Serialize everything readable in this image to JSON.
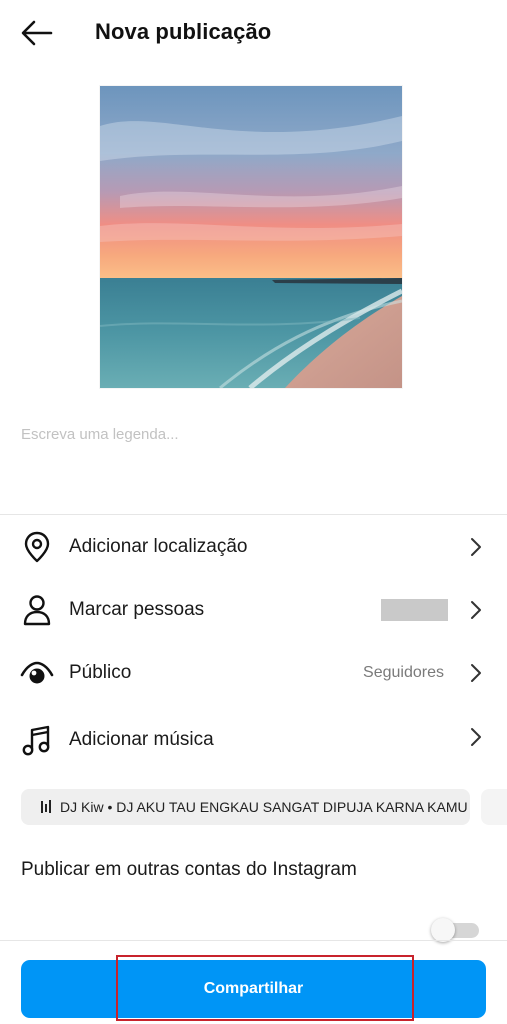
{
  "header": {
    "title": "Nova publicação",
    "back_icon": "arrow-left-icon"
  },
  "post": {
    "image": "sunset beach photo",
    "caption_placeholder": "Escreva uma legenda...",
    "caption_value": ""
  },
  "options": [
    {
      "icon": "location-pin-icon",
      "label": "Adicionar localização"
    },
    {
      "icon": "person-icon",
      "label": "Marcar pessoas"
    },
    {
      "icon": "eye-icon",
      "label": "Público",
      "value": "Seguidores"
    },
    {
      "icon": "music-note-icon",
      "label": "Adicionar música"
    }
  ],
  "music_suggestion": {
    "icon": "audio-bars-icon",
    "text": "DJ Kiw • DJ AKU TAU ENGKAU SANGAT DIPUJA KARNA KAMU"
  },
  "share_other": {
    "label": "Publicar em outras contas do Instagram",
    "toggle_on": false
  },
  "footer": {
    "share_label": "Compartilhar"
  },
  "colors": {
    "primary_button": "#0095f6",
    "highlight": "#c8232c",
    "text": "#1a1a1a",
    "secondary_text": "#7a7a7a"
  }
}
